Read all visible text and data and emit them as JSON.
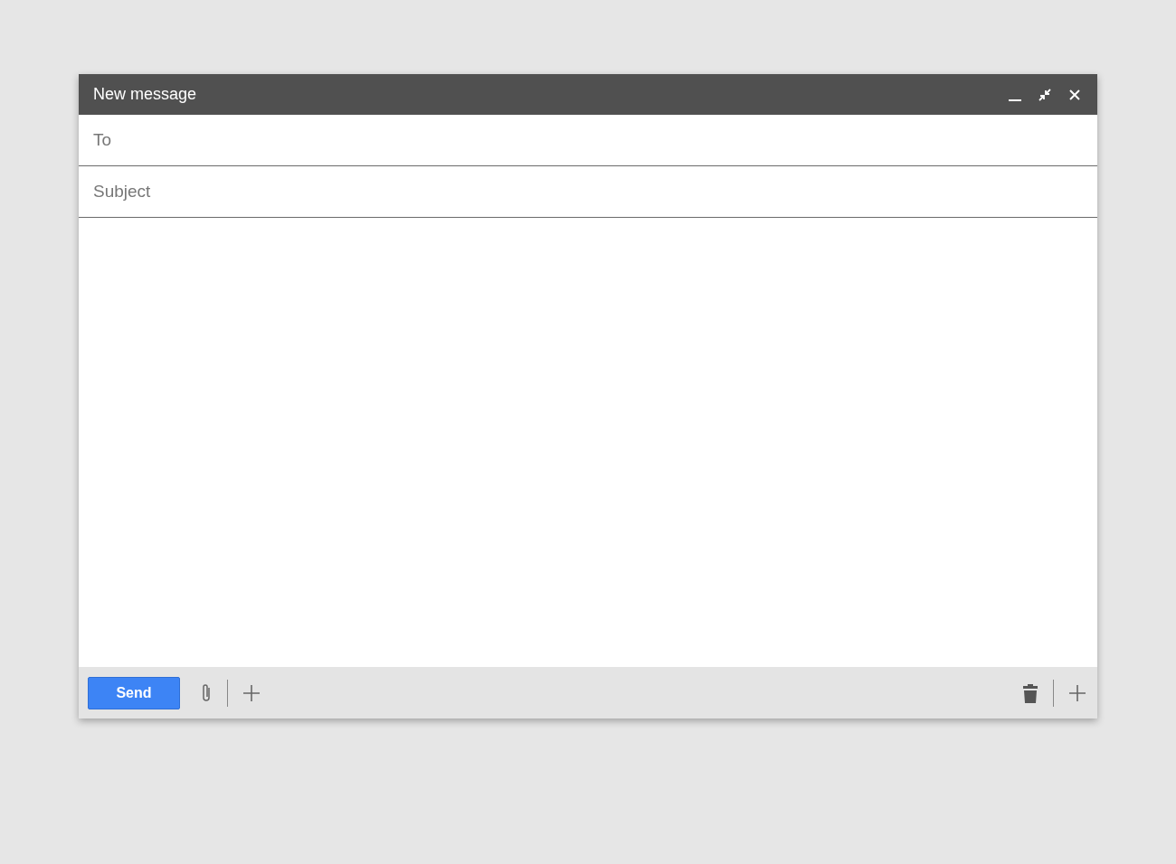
{
  "window": {
    "title": "New message"
  },
  "fields": [
    {
      "placeholder": "To"
    },
    {
      "placeholder": "Subject"
    }
  ],
  "footer": {
    "send_button": "Send"
  }
}
